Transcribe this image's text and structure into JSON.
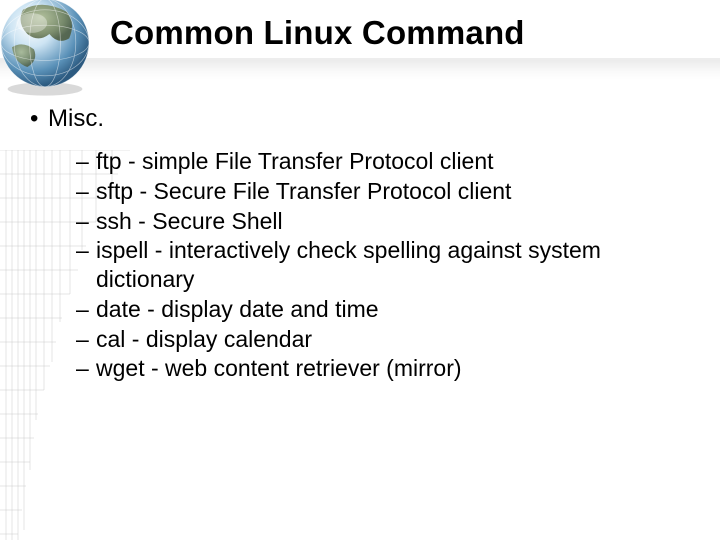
{
  "title": "Common Linux Command",
  "bullets": [
    {
      "text": "Misc.",
      "sub": [
        "ftp - simple File Transfer Protocol client",
        "sftp - Secure File Transfer Protocol client",
        "ssh - Secure Shell",
        "ispell - interactively check spelling against system dictionary",
        "date - display date and time",
        "cal - display calendar",
        "wget - web content retriever (mirror)"
      ]
    }
  ]
}
